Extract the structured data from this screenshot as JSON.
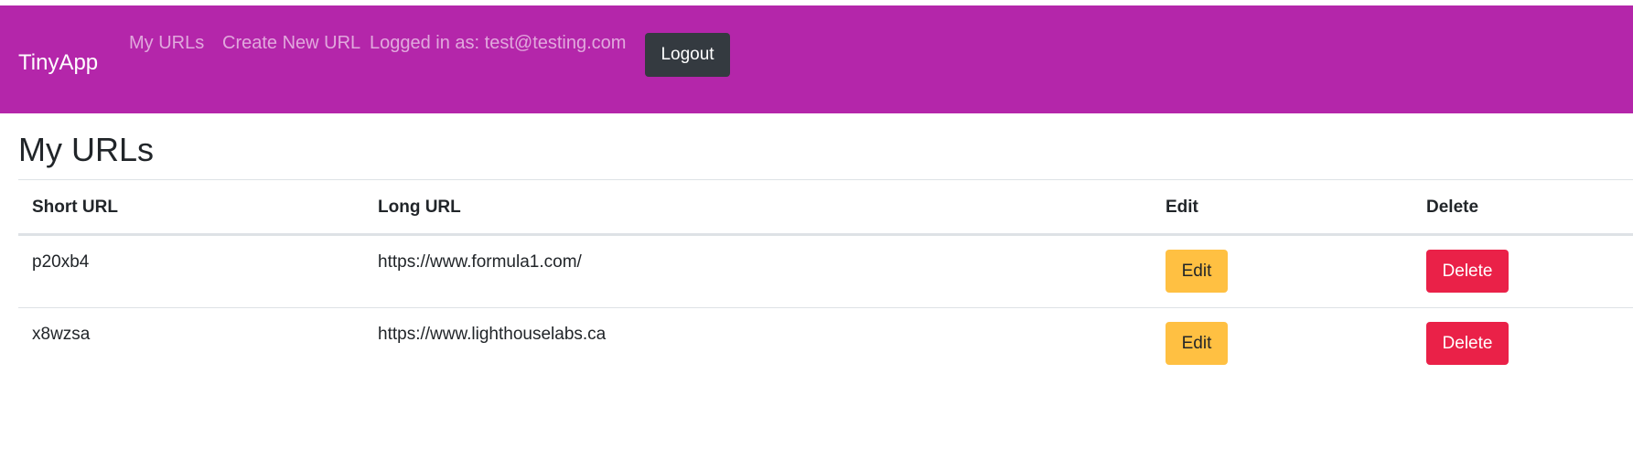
{
  "navbar": {
    "brand": "TinyApp",
    "my_urls": "My URLs",
    "create_new_url": "Create New URL",
    "logged_in": "Logged in as: test@testing.com",
    "logout": "Logout"
  },
  "main": {
    "title": "My URLs",
    "table": {
      "headers": [
        "Short URL",
        "Long URL",
        "Edit",
        "Delete"
      ],
      "rows": [
        {
          "short_url": "p20xb4",
          "long_url": "https://www.formula1.com/",
          "edit": "Edit",
          "delete": "Delete"
        },
        {
          "short_url": "x8wzsa",
          "long_url": "https://www.lighthouselabs.ca",
          "edit": "Edit",
          "delete": "Delete"
        }
      ]
    }
  },
  "colors": {
    "navbar_bg": "#b426aa",
    "logout_bg": "#343a40",
    "edit_bg": "#ffc042",
    "delete_bg": "#ea2148"
  }
}
